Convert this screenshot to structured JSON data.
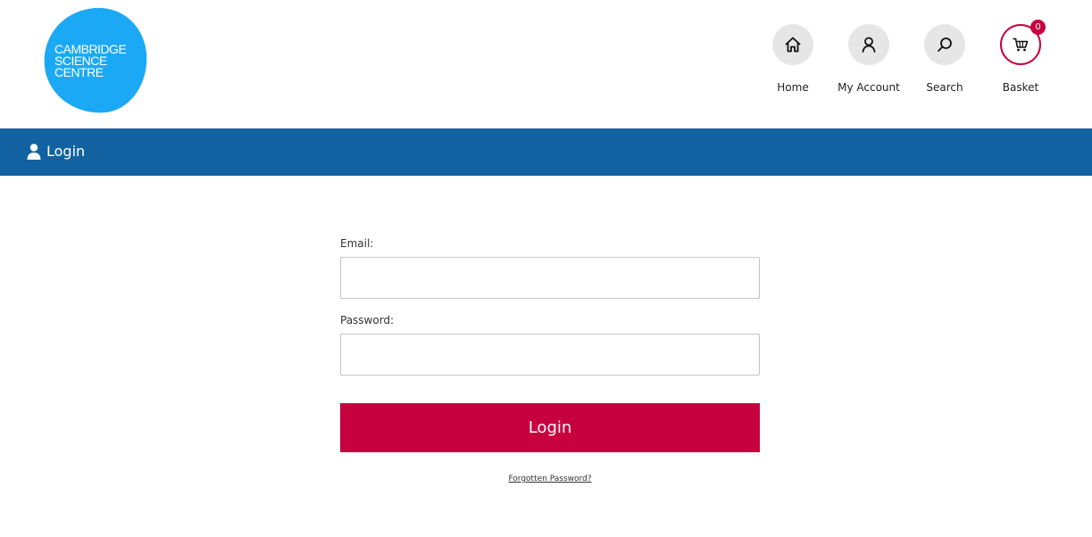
{
  "brand": {
    "logo_lines": [
      "CAMBRIDGE",
      "SCIENCE",
      "CENTRE"
    ],
    "logo_color": "#1ba9f5"
  },
  "nav": {
    "items": [
      {
        "label": "Home",
        "icon": "home-icon"
      },
      {
        "label": "My Account",
        "icon": "user-icon"
      },
      {
        "label": "Search",
        "icon": "search-icon"
      },
      {
        "label": "Basket",
        "icon": "cart-icon"
      }
    ],
    "basket_count": "0"
  },
  "title_bar": {
    "title": "Login",
    "icon": "user-icon",
    "color": "#1262a1"
  },
  "form": {
    "email_label": "Email:",
    "email_value": "",
    "password_label": "Password:",
    "password_value": "",
    "submit_label": "Login",
    "submit_color": "#c7003f",
    "forgot_label": "Forgotten Password?"
  }
}
